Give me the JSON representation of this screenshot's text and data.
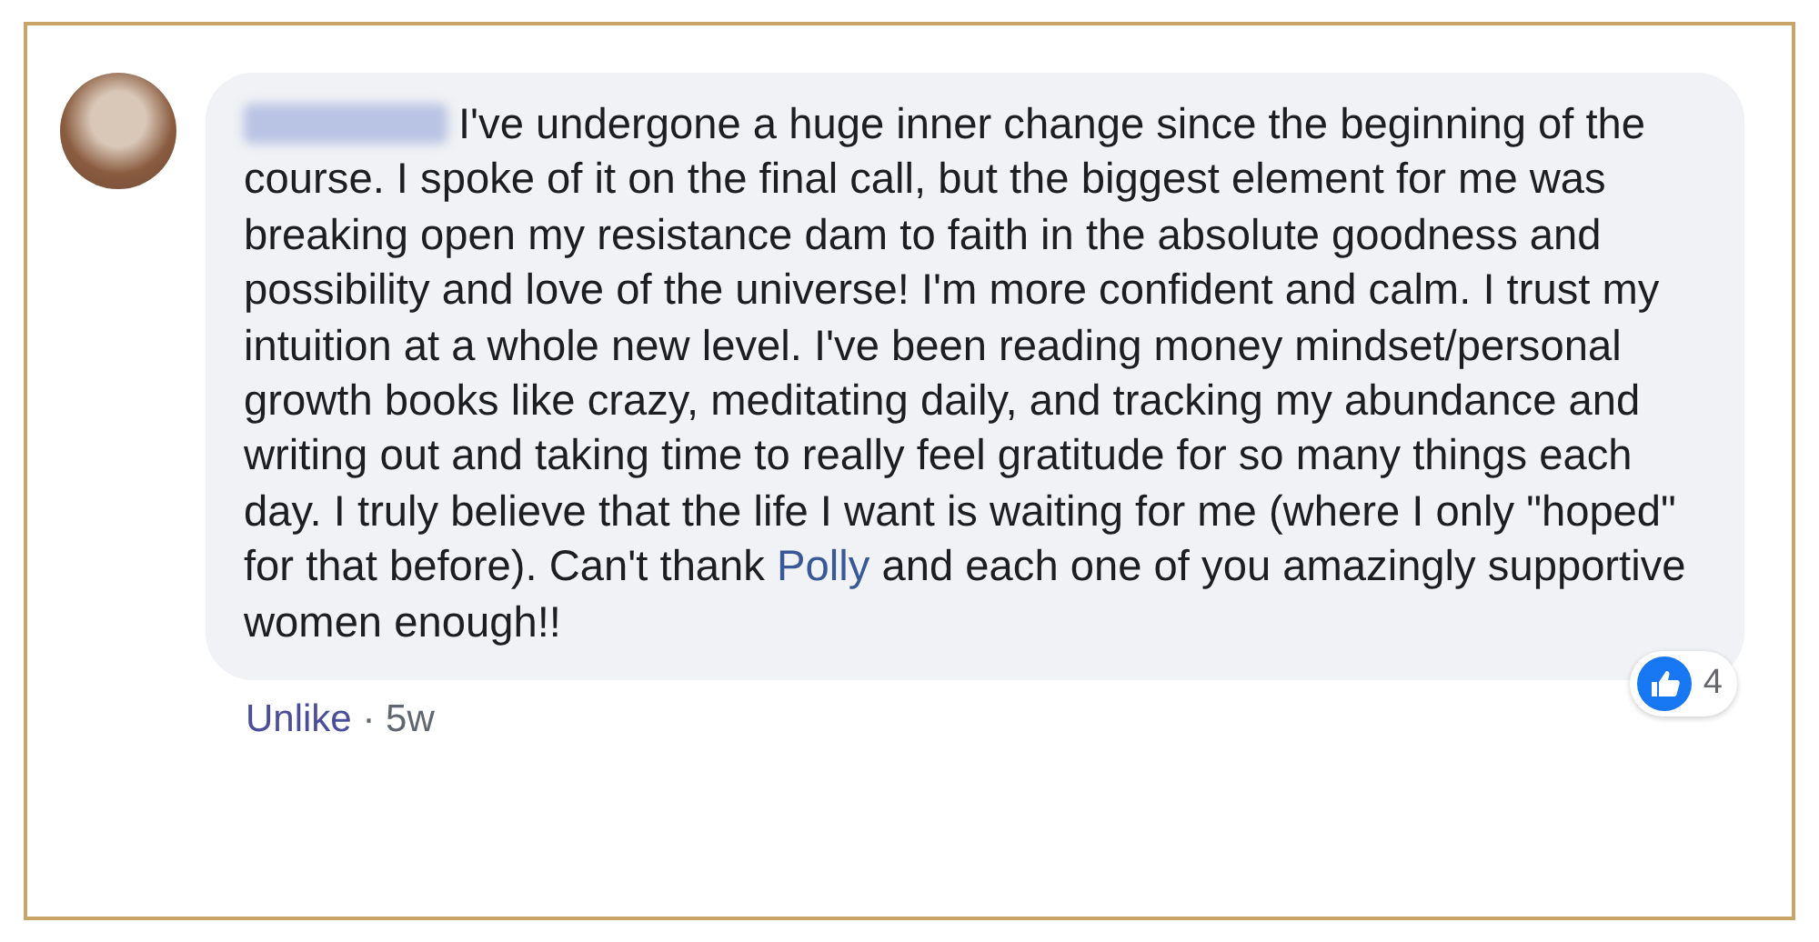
{
  "comment": {
    "text_before": "I've undergone a huge inner change since the beginning of the course. I spoke of it on the final call, but the biggest element for me was breaking open my resistance dam to faith in the absolute goodness and possibility and love of the universe! I'm more confident and calm. I trust my intuition at a whole new level. I've been reading money mindset/personal growth books like crazy, meditating daily, and tracking my abundance and writing out and taking time to really feel gratitude for so many things each day. I truly believe that the life I want is waiting for me (where I only \"hoped\" for that before). Can't thank",
    "mention": "Polly",
    "text_after": "and each one of you amazingly supportive women enough!!",
    "reaction_count": "4",
    "action": "Unlike",
    "separator": "·",
    "time": "5w"
  }
}
